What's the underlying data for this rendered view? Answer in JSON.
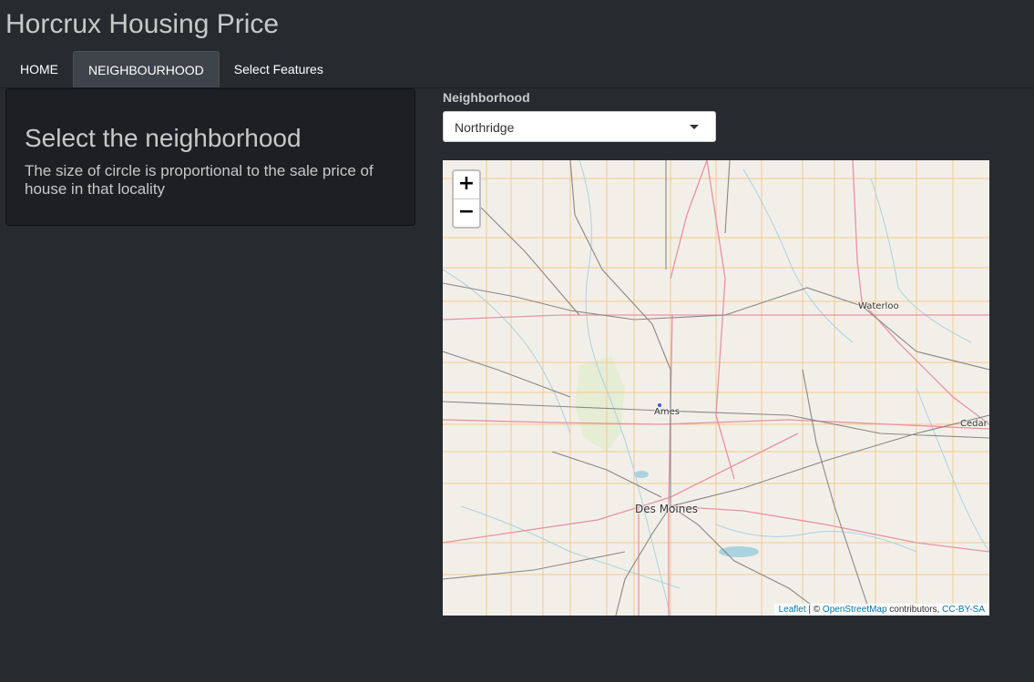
{
  "app": {
    "title": "Horcrux Housing Price"
  },
  "nav": {
    "tabs": [
      {
        "label": "HOME",
        "active": false
      },
      {
        "label": "NEIGHBOURHOOD",
        "active": true
      },
      {
        "label": "Select Features",
        "active": false
      }
    ]
  },
  "side_panel": {
    "heading": "Select the neighborhood",
    "description": "The size of circle is proportional to the sale price of house in that locality"
  },
  "neighborhood_select": {
    "label": "Neighborhood",
    "selected": "Northridge"
  },
  "map": {
    "zoom_in_label": "+",
    "zoom_out_label": "−",
    "cities": {
      "waterloo": "Waterloo",
      "ames": "Ames",
      "cedar": "Cedar",
      "des_moines": "Des Moines"
    },
    "attribution": {
      "leaflet": "Leaflet",
      "separator": " | © ",
      "osm": "OpenStreetMap",
      "contributors": " contributors, ",
      "license": "CC-BY-SA"
    }
  },
  "colors": {
    "background": "#272b30",
    "panel": "#1e1f23",
    "active_tab": "#3e444c",
    "map_land": "#f2efe9",
    "highway": "#e892a2",
    "county_line": "#f5c98a",
    "river": "#aad3df",
    "road": "#888888",
    "link": "#0078a8"
  }
}
